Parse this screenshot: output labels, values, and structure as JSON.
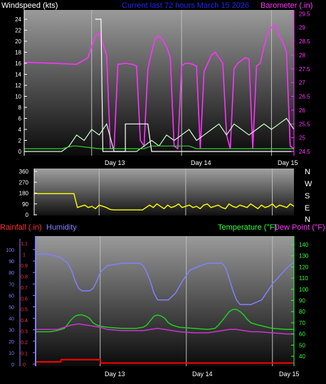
{
  "title": "Current last 72 hours March 15 2026",
  "day_labels": [
    "Day 13",
    "Day 14",
    "Day 15"
  ],
  "colors": {
    "windspeed": "#ff33ff",
    "wind_avg": "#ccffcc",
    "wind_ref": "#33cc33",
    "direction": "#ffff00",
    "humidity": "#8080ff",
    "temperature": "#22cc22",
    "dewpoint": "#cc33cc",
    "rainfall": "#ff0000",
    "white_trace": "#ffffff",
    "title": "#2222ff"
  },
  "chart_data": [
    {
      "type": "line",
      "name": "wind-barometer",
      "ylabel": "Windspeed (kts)",
      "ylabel_right": "Barometer (.in)",
      "ylim": [
        0,
        25
      ],
      "ylim_right": [
        24.5,
        29.5
      ],
      "y_ticks": [
        "0",
        "2",
        "4",
        "6",
        "8",
        "10",
        "12",
        "14",
        "16",
        "18",
        "20",
        "22",
        "24"
      ],
      "y_ticks_right": [
        "24.5",
        "25",
        "25.5",
        "26",
        "26.5",
        "27",
        "27.5",
        "28",
        "28.5",
        "29",
        "29.5"
      ],
      "xlim": [
        0,
        72
      ],
      "series": [
        {
          "key": "windspeed",
          "x": [
            0,
            8,
            14,
            17,
            19,
            20,
            21,
            22,
            23,
            24,
            25,
            26,
            27,
            28,
            29,
            30,
            31,
            32,
            33,
            34,
            35,
            36,
            37,
            38,
            39,
            40,
            41,
            42,
            43,
            44,
            45,
            46,
            47,
            48,
            49,
            50,
            51,
            52,
            53,
            54,
            55,
            56,
            57,
            58,
            59,
            60,
            61,
            62,
            63,
            64,
            65,
            66,
            67,
            68,
            69,
            70,
            71,
            72
          ],
          "y": [
            16.2,
            16.0,
            15.8,
            17.0,
            21.0,
            21.5,
            19.5,
            17.5,
            0.5,
            0.5,
            15.8,
            15.9,
            16.0,
            15.9,
            15.8,
            15.5,
            2.0,
            1.0,
            15.0,
            18.0,
            20.5,
            21.0,
            20.2,
            19.0,
            17.0,
            1.0,
            0.5,
            15.5,
            16.0,
            16.0,
            15.8,
            15.5,
            0.5,
            14.5,
            16.0,
            17.5,
            18.0,
            17.0,
            16.0,
            3.0,
            0.5,
            15.0,
            16.0,
            16.5,
            17.0,
            16.8,
            0.5,
            15.5,
            16.0,
            19.0,
            21.5,
            22.5,
            23.0,
            21.0,
            20.0,
            18.0,
            1.0,
            0.5
          ]
        },
        {
          "key": "wind_avg",
          "x": [
            0,
            2,
            4,
            6,
            8,
            10,
            12,
            14,
            16,
            18,
            20,
            22,
            24,
            26,
            28,
            30,
            32,
            34,
            36,
            38,
            40,
            42,
            44,
            46,
            48,
            50,
            52,
            54,
            56,
            58,
            60,
            62,
            64,
            66,
            68,
            70,
            72
          ],
          "y": [
            0,
            0,
            0,
            0,
            0,
            0,
            1,
            3,
            2,
            4,
            3,
            5,
            0,
            0,
            0,
            0,
            1,
            2,
            1,
            3,
            2,
            3,
            4,
            2,
            3,
            4,
            5,
            3,
            5,
            4,
            3,
            4,
            5,
            4,
            5,
            6,
            4
          ]
        },
        {
          "key": "wind_ref",
          "x": [
            0,
            10,
            13,
            14,
            20,
            22,
            32,
            34,
            44,
            46,
            56,
            72
          ],
          "y": [
            0.5,
            0.5,
            1.0,
            1.0,
            0.5,
            0.5,
            0.5,
            1.0,
            1.0,
            0.5,
            0.5,
            0.5
          ]
        },
        {
          "key": "white_trace",
          "x": [
            19,
            19.5,
            20.5,
            21,
            27,
            27,
            33,
            33,
            34,
            41,
            43,
            48,
            50,
            52,
            57,
            62,
            68,
            72
          ],
          "y": [
            24,
            24,
            24,
            0,
            0,
            5,
            5,
            5,
            0,
            0,
            0,
            0,
            0,
            0,
            0,
            0,
            0,
            0
          ]
        }
      ]
    },
    {
      "type": "line",
      "name": "wind-direction",
      "ylim": [
        0,
        360
      ],
      "y_ticks": [
        "0",
        "90",
        "180",
        "270",
        "360"
      ],
      "compass_labels": [
        "N",
        "W",
        "S",
        "E",
        "N"
      ],
      "xlim": [
        0,
        72
      ],
      "series": [
        {
          "key": "direction",
          "x": [
            0,
            11,
            12,
            13,
            14,
            15,
            16,
            17,
            18,
            19,
            20,
            21,
            22,
            23,
            24,
            26,
            28,
            30,
            31,
            32,
            33,
            34,
            35,
            36,
            37,
            38,
            39,
            40,
            41,
            42,
            43,
            44,
            45,
            46,
            47,
            48,
            49,
            50,
            51,
            52,
            53,
            54,
            55,
            56,
            57,
            58,
            59,
            60,
            61,
            62,
            63,
            64,
            65,
            66,
            67,
            68,
            69,
            70,
            71,
            72
          ],
          "y": [
            175,
            175,
            60,
            70,
            80,
            60,
            70,
            50,
            80,
            70,
            60,
            45,
            40,
            40,
            40,
            40,
            40,
            40,
            60,
            80,
            60,
            90,
            70,
            50,
            80,
            60,
            70,
            90,
            60,
            70,
            80,
            60,
            70,
            50,
            80,
            90,
            60,
            70,
            80,
            60,
            50,
            90,
            70,
            60,
            80,
            70,
            60,
            90,
            70,
            50,
            80,
            60,
            70,
            90,
            60,
            80,
            70,
            60,
            90,
            70
          ]
        }
      ]
    },
    {
      "type": "line",
      "name": "rain-humidity-temperature",
      "ylabel": "Rainfall (.in)",
      "ylabel2": "Humidity",
      "ylabel_right": "Temperature (°F)",
      "ylabel_right2": "Dew Point (°F)",
      "ylim_rain": [
        0,
        1.15
      ],
      "ylim_humidity": [
        0,
        100
      ],
      "ylim_temp": [
        30,
        145
      ],
      "y_ticks_rain": [
        "0",
        "0.1",
        "0.2",
        "0.3",
        "0.4",
        "0.5",
        "0.6",
        "0.7",
        "0.8",
        "0.9",
        "1",
        "1.1"
      ],
      "y_ticks_humidity": [
        "0",
        "10",
        "20",
        "30",
        "40",
        "50",
        "60",
        "70",
        "80",
        "90",
        "100"
      ],
      "y_ticks_temp": [
        "40",
        "50",
        "60",
        "70",
        "80",
        "90",
        "100",
        "110",
        "120",
        "130",
        "140"
      ],
      "xlim": [
        0,
        72
      ],
      "series": [
        {
          "key": "humidity",
          "x": [
            0,
            3,
            5,
            7,
            9,
            10,
            11,
            12,
            13,
            14,
            15,
            16,
            17,
            18,
            20,
            24,
            27,
            29,
            30,
            31,
            32,
            33,
            34,
            35,
            37,
            39,
            41,
            43,
            46,
            48,
            50,
            52,
            53,
            54,
            55,
            56,
            57,
            58,
            60,
            63,
            66,
            70,
            72
          ],
          "y": [
            96,
            96,
            95,
            93,
            88,
            82,
            73,
            66,
            64,
            64,
            64,
            66,
            72,
            80,
            86,
            88,
            88,
            88,
            86,
            80,
            72,
            62,
            56,
            56,
            56,
            62,
            73,
            82,
            86,
            88,
            88,
            88,
            84,
            74,
            64,
            56,
            52,
            52,
            52,
            56,
            70,
            84,
            89
          ]
        },
        {
          "key": "temperature",
          "x": [
            0,
            4,
            6,
            8,
            9,
            10,
            11,
            12,
            13,
            14,
            15,
            16,
            17,
            18,
            20,
            24,
            28,
            30,
            31,
            32,
            33,
            34,
            35,
            36,
            37,
            38,
            40,
            44,
            48,
            50,
            51,
            52,
            53,
            54,
            55,
            56,
            57,
            58,
            59,
            60,
            62,
            66,
            70,
            72
          ],
          "y": [
            62,
            62,
            63,
            65,
            69,
            73,
            76,
            77,
            77,
            76,
            74,
            70,
            68,
            67,
            66,
            65,
            65,
            66,
            68,
            72,
            76,
            77,
            76,
            74,
            70,
            68,
            66,
            65,
            64,
            65,
            68,
            72,
            76,
            80,
            82,
            82,
            80,
            77,
            73,
            70,
            68,
            65,
            64,
            64
          ]
        },
        {
          "key": "dewpoint",
          "x": [
            0,
            4,
            6,
            8,
            10,
            12,
            14,
            16,
            18,
            20,
            24,
            28,
            30,
            32,
            34,
            36,
            38,
            40,
            44,
            48,
            50,
            52,
            54,
            56,
            58,
            60,
            62,
            66,
            70,
            72
          ],
          "y": [
            64,
            64,
            64,
            66,
            68,
            69,
            68,
            67,
            66,
            64,
            63,
            63,
            63,
            64,
            65,
            64,
            63,
            62,
            61,
            61,
            62,
            63,
            64,
            64,
            63,
            62,
            62,
            61,
            60,
            60
          ]
        },
        {
          "key": "rainfall",
          "x": [
            0,
            7,
            7.1,
            18,
            18.1,
            72
          ],
          "y": [
            0.02,
            0.02,
            0.04,
            0.04,
            0.01,
            0.01
          ]
        }
      ]
    }
  ]
}
